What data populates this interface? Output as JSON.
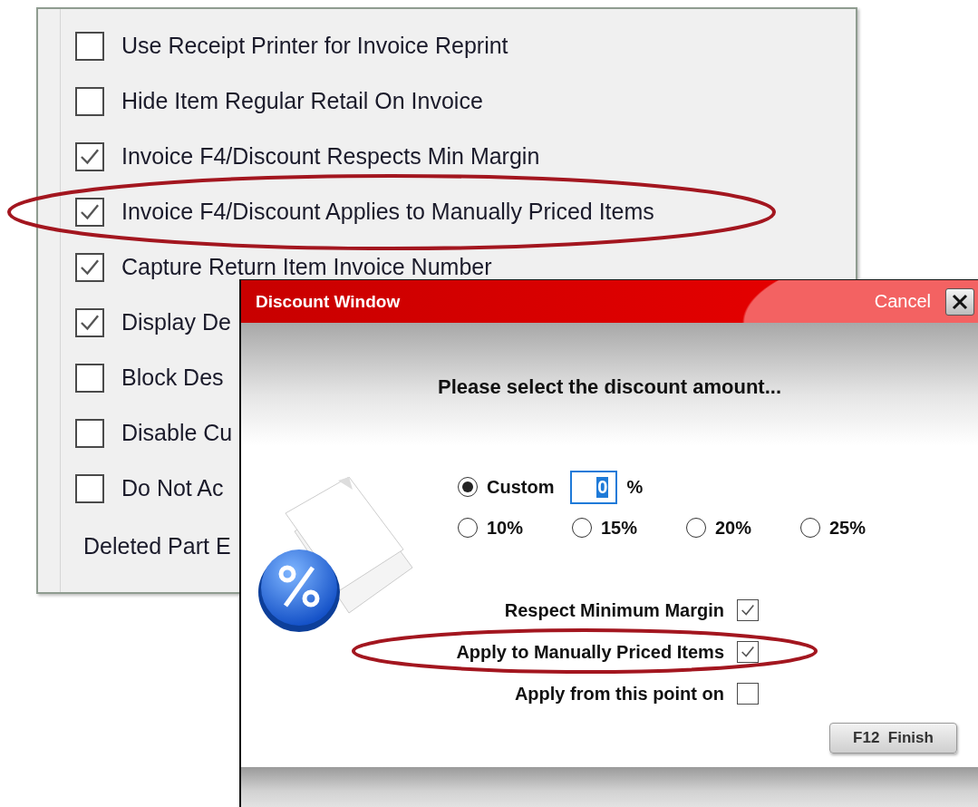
{
  "settings_panel": {
    "options": [
      {
        "label": "Use Receipt Printer for Invoice Reprint",
        "checked": false
      },
      {
        "label": "Hide Item Regular Retail On Invoice",
        "checked": false
      },
      {
        "label": "Invoice F4/Discount Respects Min Margin",
        "checked": true
      },
      {
        "label": "Invoice F4/Discount Applies to Manually Priced Items",
        "checked": true
      },
      {
        "label": "Capture Return Item Invoice Number",
        "checked": true
      },
      {
        "label": "Display De",
        "checked": true
      },
      {
        "label": "Block Des",
        "checked": false
      },
      {
        "label": "Disable Cu",
        "checked": false
      },
      {
        "label": "Do Not Ac",
        "checked": false
      }
    ],
    "footer_label": "Deleted Part E"
  },
  "dialog": {
    "title": "Discount Window",
    "cancel": "Cancel",
    "prompt": "Please select the discount amount...",
    "custom": {
      "label": "Custom",
      "selected": true,
      "value": "0",
      "unit": "%"
    },
    "presets": [
      {
        "label": "10%",
        "selected": false
      },
      {
        "label": "15%",
        "selected": false
      },
      {
        "label": "20%",
        "selected": false
      },
      {
        "label": "25%",
        "selected": false
      }
    ],
    "options": [
      {
        "label": "Respect Minimum Margin",
        "checked": true
      },
      {
        "label": "Apply to Manually Priced Items",
        "checked": true
      },
      {
        "label": "Apply from this point on",
        "checked": false
      }
    ],
    "finish_button": "F12  Finish"
  }
}
